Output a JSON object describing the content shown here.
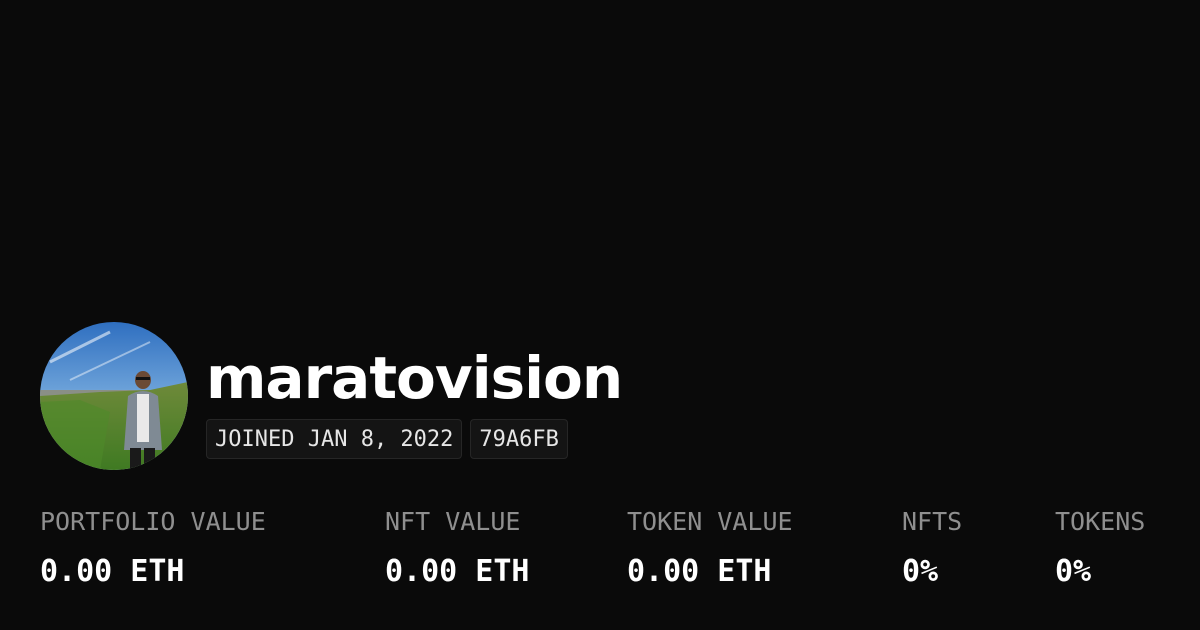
{
  "profile": {
    "username": "maratovision",
    "avatar_icon": "profile-photo",
    "joined": "JOINED JAN 8, 2022",
    "address_short": "79A6FB"
  },
  "stats": [
    {
      "label": "PORTFOLIO VALUE",
      "value": "0.00 ETH"
    },
    {
      "label": "NFT VALUE",
      "value": "0.00 ETH"
    },
    {
      "label": "TOKEN VALUE",
      "value": "0.00 ETH"
    },
    {
      "label": "NFTS",
      "value": "0%"
    },
    {
      "label": "TOKENS",
      "value": "0%"
    }
  ],
  "colors": {
    "background": "#0a0a0a",
    "text_primary": "#ffffff",
    "text_secondary": "#8f8f8f",
    "badge_background": "#141414",
    "badge_border": "#262626"
  }
}
